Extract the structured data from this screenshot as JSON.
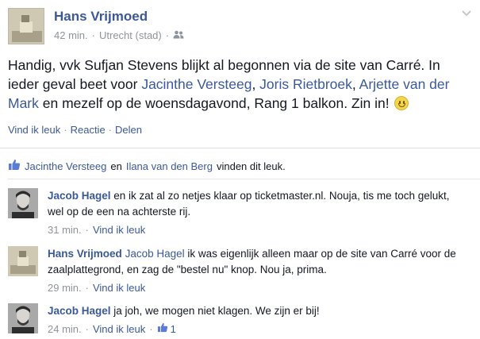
{
  "post": {
    "author": "Hans Vrijmoed",
    "time": "42 min.",
    "location": "Utrecht (stad)",
    "text_part1": "Handig, vvk Sufjan Stevens blijkt al begonnen via de site van Carré. In ieder geval beet voor ",
    "tag1": "Jacinthe Versteeg",
    "comma1": ", ",
    "tag2": "Joris Rietbroek",
    "comma2": ", ",
    "tag3": "Arjette van der Mark",
    "text_part2": " en mezelf op de woensdagavond, Rang 1 balkon. Zin in! ",
    "icons": {
      "audience": "friends-icon",
      "menu": "chevron-down-icon",
      "emoji": "smiley-icon"
    }
  },
  "actions": {
    "like": "Vind ik leuk",
    "comment": "Reactie",
    "share": "Delen",
    "separator": "·"
  },
  "likes": {
    "person1": "Jacinthe Versteeg",
    "conj": "en",
    "person2": "Ilana van den Berg",
    "suffix": "vinden dit leuk."
  },
  "comments": [
    {
      "author": "Jacob Hagel",
      "text": " en ik zat al zo netjes klaar op ticketmaster.nl. Nouja, tis me toch gelukt, wel op de een na achterste rij.",
      "time": "31 min.",
      "like": "Vind ik leuk"
    },
    {
      "author": "Hans Vrijmoed",
      "mention": "Jacob Hagel",
      "text": " ik was eigenlijk alleen maar op de site van Carré voor de zaalplattegrond, en zag de \"bestel nu\" knop. Nou ja, prima.",
      "time": "29 min.",
      "like": "Vind ik leuk"
    },
    {
      "author": "Jacob Hagel",
      "text": " ja joh, we mogen niet klagen. We zijn er bij!",
      "time": "24 min.",
      "like": "Vind ik leuk",
      "like_count": "1"
    }
  ],
  "colors": {
    "link": "#3b5998",
    "meta": "#8f949c",
    "text": "#141823"
  }
}
